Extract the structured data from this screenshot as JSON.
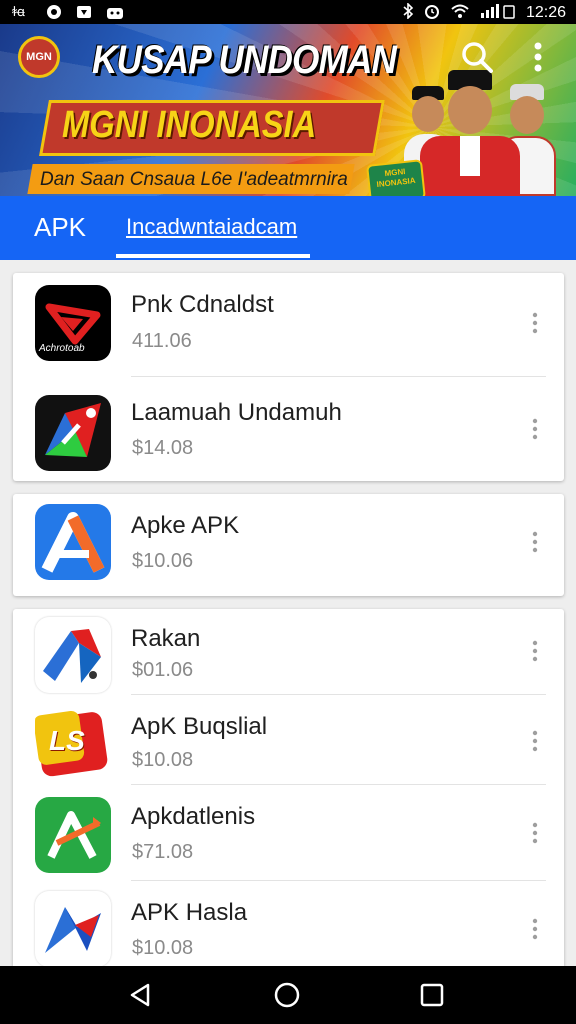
{
  "status_bar": {
    "left_icons": [
      "notification-icon",
      "sync-icon",
      "message-icon",
      "android-icon"
    ],
    "left_text": "ꬸꬰ",
    "right_icons": [
      "bluetooth-icon",
      "alarm-icon",
      "wifi-icon",
      "signal-icon"
    ],
    "time": "12:26"
  },
  "banner": {
    "title": "KUSAP UNDOMAN",
    "subtitle_main": "MGNI INONASIA",
    "tagline": "Dan Saan Cnsaua L6e I'adeatmrnira",
    "badge": "MGNI INONASIA",
    "logo_text": "MGN"
  },
  "tabs": [
    {
      "label": "APK"
    },
    {
      "label": "Incadwntaiadcam"
    }
  ],
  "cards": [
    {
      "items": [
        {
          "name": "Pnk Cdnaldst",
          "price": "411.06",
          "icon": "play-triangle-logo-icon",
          "icon_caption": "Achrotoab"
        },
        {
          "name": "Laamuah Undamuh",
          "price": "$14.08",
          "icon": "colorful-arrow-logo-icon"
        }
      ]
    },
    {
      "items": [
        {
          "name": "Apke APK",
          "price": "$10.06",
          "icon": "letter-a-logo-icon"
        }
      ]
    },
    {
      "items": [
        {
          "name": "Rakan",
          "price": "$01.06",
          "icon": "tricolor-chevron-logo-icon"
        },
        {
          "name": "ApK Buqslial",
          "price": "$10.08",
          "icon": "ls-letters-logo-icon",
          "icon_caption": "LS"
        },
        {
          "name": "Apkdatlenis",
          "price": "$71.08",
          "icon": "green-arrow-logo-icon"
        },
        {
          "name": "APK Hasla",
          "price": "$10.08",
          "icon": "blue-arrow-logo-icon"
        }
      ]
    }
  ],
  "nav_bar": {
    "buttons": [
      "back-icon",
      "home-icon",
      "recents-icon"
    ]
  },
  "colors": {
    "tab_bar": "#1565f5",
    "background": "#eeeeee",
    "price_text": "#8a8a8a"
  }
}
